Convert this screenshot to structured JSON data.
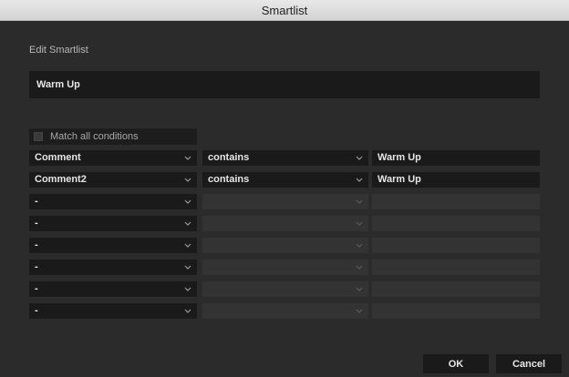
{
  "window": {
    "title": "Smartlist"
  },
  "dialog": {
    "heading": "Edit Smartlist",
    "name_value": "Warm Up",
    "match_all_label": "Match all conditions",
    "match_all_checked": false
  },
  "rules": [
    {
      "field": "Comment",
      "operator": "contains",
      "value": "Warm Up",
      "enabled": true
    },
    {
      "field": "Comment2",
      "operator": "contains",
      "value": "Warm Up",
      "enabled": true
    },
    {
      "field": "-",
      "operator": "",
      "value": "",
      "enabled": false
    },
    {
      "field": "-",
      "operator": "",
      "value": "",
      "enabled": false
    },
    {
      "field": "-",
      "operator": "",
      "value": "",
      "enabled": false
    },
    {
      "field": "-",
      "operator": "",
      "value": "",
      "enabled": false
    },
    {
      "field": "-",
      "operator": "",
      "value": "",
      "enabled": false
    },
    {
      "field": "-",
      "operator": "",
      "value": "",
      "enabled": false
    }
  ],
  "buttons": {
    "ok": "OK",
    "cancel": "Cancel"
  }
}
